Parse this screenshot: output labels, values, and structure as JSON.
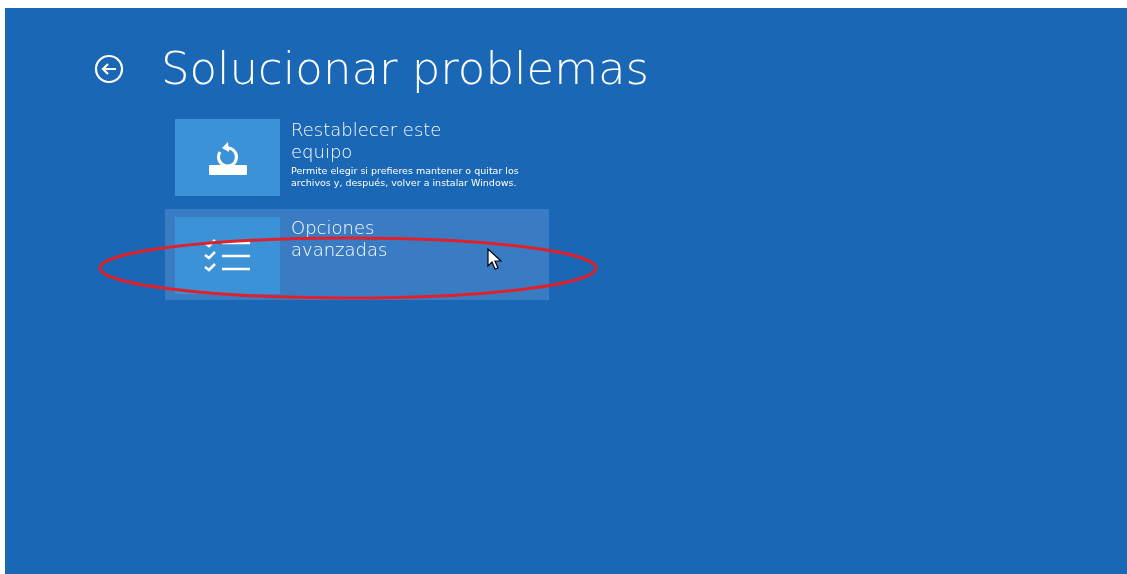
{
  "header": {
    "title": "Solucionar problemas"
  },
  "options": [
    {
      "kind": "reset",
      "title": "Restablecer este equipo",
      "description": "Permite elegir si prefieres mantener o quitar los archivos y, después, volver a instalar Windows.",
      "selected": false
    },
    {
      "kind": "advanced",
      "title": "Opciones avanzadas",
      "selected": true
    }
  ]
}
